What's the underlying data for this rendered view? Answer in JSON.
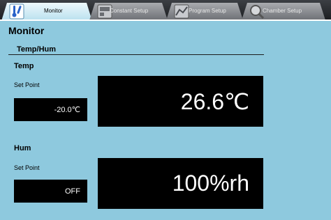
{
  "tabs": [
    {
      "label": "Monitor",
      "icon": "thermometer-icon",
      "active": true
    },
    {
      "label": "Constant Setup",
      "icon": "constant-setup-icon",
      "active": false
    },
    {
      "label": "Program Setup",
      "icon": "program-setup-icon",
      "active": false
    },
    {
      "label": "Chamber Setup",
      "icon": "magnifier-icon",
      "active": false
    }
  ],
  "page": {
    "title": "Monitor",
    "section": "Temp/Hum"
  },
  "temp": {
    "label": "Temp",
    "setpoint_label": "Set Point",
    "setpoint_value": "-20.0℃",
    "present_value": "26.6℃"
  },
  "hum": {
    "label": "Hum",
    "setpoint_label": "Set Point",
    "setpoint_value": "OFF",
    "present_value": "100%rh"
  },
  "colors": {
    "background": "#8ec9de",
    "tab_active": "#d8eff7",
    "display": "#000000"
  }
}
